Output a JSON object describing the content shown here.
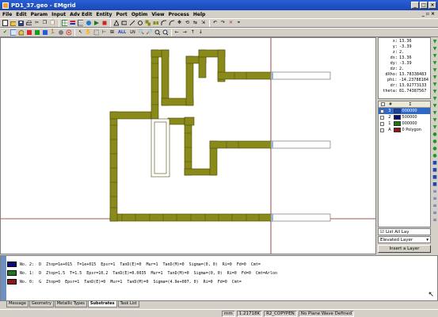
{
  "window": {
    "title": "PD1_37.geo - EMgrid"
  },
  "menu": [
    "File",
    "Edit",
    "Param",
    "Input",
    "Adv Edit",
    "Entity",
    "Port",
    "Optim",
    "View",
    "Process",
    "Help"
  ],
  "toolbar2_labels": {
    "all": "ALL",
    "ln": "LN"
  },
  "info": [
    {
      "k": "x:",
      "v": "13.36"
    },
    {
      "k": "y:",
      "v": "-3.39"
    },
    {
      "k": "z:",
      "v": "2."
    },
    {
      "k": "dx:",
      "v": "13.36"
    },
    {
      "k": "dy:",
      "v": "-3.39"
    },
    {
      "k": "dz:",
      "v": "2."
    },
    {
      "k": "dXho:",
      "v": "13.78338483"
    },
    {
      "k": "phi:",
      "v": "-14.23788184"
    },
    {
      "k": "dr:",
      "v": "13.92773133"
    },
    {
      "k": "theta:",
      "v": "81.74387567"
    }
  ],
  "layers": {
    "header": [
      "",
      "#",
      "Σ"
    ],
    "rows": [
      {
        "num": "3",
        "color": "#1a3fb8",
        "value": "000000",
        "selected": true
      },
      {
        "num": "2",
        "color": "#0a0a7a",
        "value": "500000",
        "selected": false
      },
      {
        "num": "1",
        "color": "#1a7a1a",
        "value": "000000",
        "selected": false
      },
      {
        "num": "A",
        "color": "#8a1a1a",
        "value": "0 Polygon",
        "selected": false
      }
    ]
  },
  "layer_controls": {
    "list_all": "List All Lay",
    "select_value": "Elevated Layer",
    "insert_button": "Insert a Layer"
  },
  "substrates": [
    {
      "color": "#0a0a7a",
      "no": "No. 2:",
      "type": "D",
      "ztop": "Ztop=1e+015",
      "t": "T=1e+015",
      "eps": "Epsr=1",
      "tand": "TanD(E)=0",
      "mur": "Mur=1",
      "tandm": "TanD(M)=0",
      "sigma": "Sigma=(0, 0)",
      "ri": "Ri=0",
      "fd": "Fd=0",
      "cmt": "Cmt="
    },
    {
      "color": "#1a7a1a",
      "no": "No. 1:",
      "type": "D",
      "ztop": "Ztop=1.5",
      "t": "T=1.5",
      "eps": "Epsr=10.2",
      "tand": "TanD(E)=0.0035",
      "mur": "Mur=1",
      "tandm": "TanD(M)=0",
      "sigma": "Sigma=(0, 0)",
      "ri": "Ri=0",
      "fd": "Fd=0",
      "cmt": "Cmt=Arlon"
    },
    {
      "color": "#8a1a1a",
      "no": "No. 0:",
      "type": "G",
      "ztop": "Ztop=0",
      "t": "Epsr=1",
      "eps": "TanD(E)=0",
      "tand": "Mur=1",
      "mur": "TanD(M)=0",
      "tandm": "Sigma=(4.9e+007, 0)",
      "sigma": "Ri=0",
      "ri": "Fd=0",
      "fd": "Cmt=",
      "cmt": ""
    }
  ],
  "tabs": [
    "Message",
    "Geometry",
    "Metallic Types",
    "Substrates",
    "Task List"
  ],
  "active_tab": "Substrates",
  "status": [
    "mm",
    "1.21718K",
    "R2_COPYPEN",
    "No Plane Wave Defined"
  ],
  "colors": {
    "trace": "#8a8a1a",
    "trace_edge": "#4a4a08",
    "layer_line": "#8b1a1a"
  }
}
